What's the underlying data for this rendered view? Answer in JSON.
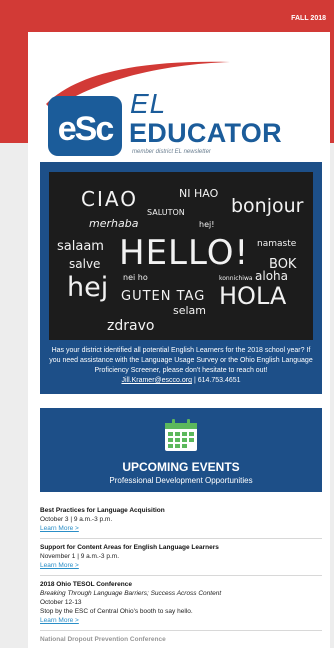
{
  "header": {
    "edition": "FALL 2018"
  },
  "logo": {
    "mark_text": "eSc",
    "title_top": "EL",
    "title_bottom": "EDUCATOR",
    "tagline": "member district EL newsletter"
  },
  "hero": {
    "words": [
      "CIAO",
      "NI HAO",
      "bonjour",
      "SALUTON",
      "merhaba",
      "hej!",
      "salaam",
      "HELLO!",
      "namaste",
      "salve",
      "BOK",
      "hej",
      "nei ho",
      "konnichiwa",
      "aloha",
      "GUTEN TAG",
      "HOLA",
      "selam",
      "zdravo"
    ],
    "message": "Has your district identified all potential English Learners for the 2018 school year? If you need assistance with the Language Usage Survey or the Ohio English Language Proficiency Screener, please don't hesitate to reach out!",
    "contact_email": "Jill.Kramer@escco.org",
    "contact_phone": "| 614.753.4651"
  },
  "events_banner": {
    "icon": "calendar-icon",
    "title": "UPCOMING EVENTS",
    "subtitle": "Professional Development Opportunities"
  },
  "events": [
    {
      "title": "Best Practices for Language Acquisition",
      "date": "October 3 | 9 a.m.-3 p.m.",
      "link": "Learn More >"
    },
    {
      "title": "Support for Content Areas for English Language Learners",
      "date": "November 1 | 9 a.m.-3 p.m.",
      "link": "Learn More >"
    },
    {
      "title": "2018 Ohio TESOL Conference",
      "subtitle": "Breaking Through Language Barriers; Success Across Content",
      "date": "October 12-13",
      "note": "Stop by the ESC of Central Ohio's booth to say hello.",
      "link": "Learn More >"
    },
    {
      "title": "National Dropout Prevention Conference"
    }
  ],
  "colors": {
    "red": "#d23a36",
    "blue": "#1d4f88",
    "link": "#2a8ec7"
  }
}
